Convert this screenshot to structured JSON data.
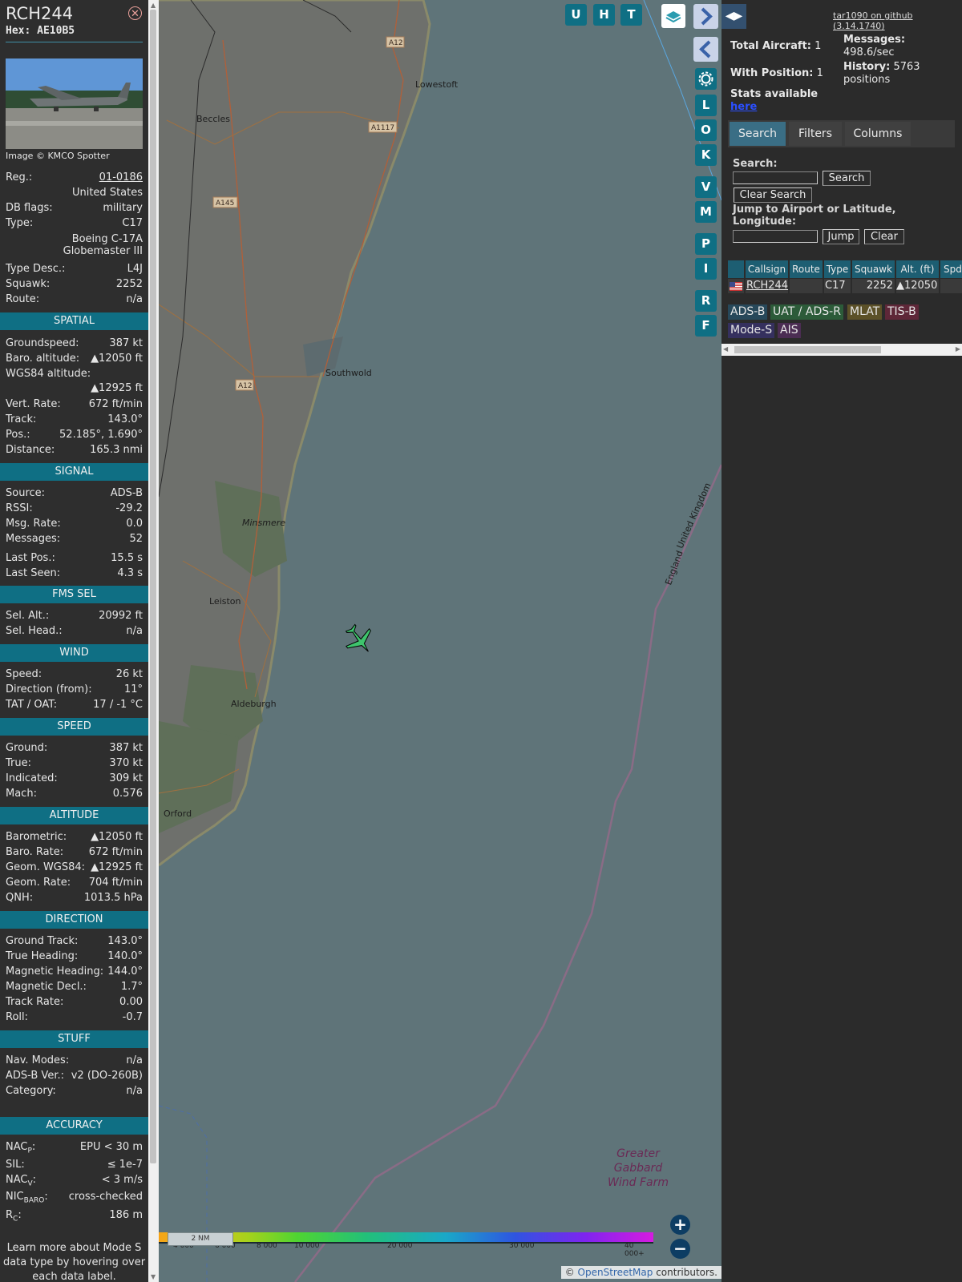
{
  "selected": {
    "callsign": "RCH244",
    "hex": "Hex: AE10B5",
    "photo_credit": "Image © KMCO Spotter",
    "summary": [
      {
        "k": "Reg.:",
        "v": "01-0186",
        "link": true
      },
      {
        "k": "",
        "v": "United States"
      },
      {
        "k": "DB flags:",
        "v": "military"
      },
      {
        "k": "Type:",
        "v": "C17"
      }
    ],
    "type_full_1": "Boeing C-17A",
    "type_full_2": "Globemaster III",
    "summary2": [
      {
        "k": "Type Desc.:",
        "v": "L4J"
      },
      {
        "k": "Squawk:",
        "v": "2252"
      },
      {
        "k": "Route:",
        "v": "n/a"
      }
    ],
    "spatial_title": "SPATIAL",
    "spatial": [
      {
        "k": "Groundspeed:",
        "v": "387 kt"
      },
      {
        "k": "Baro. altitude:",
        "v": "▲12050 ft"
      },
      {
        "k": "WGS84 altitude:",
        "v": ""
      }
    ],
    "wgs84_value": "▲12925 ft",
    "spatial2": [
      {
        "k": "Vert. Rate:",
        "v": "672 ft/min"
      },
      {
        "k": "Track:",
        "v": "143.0°"
      },
      {
        "k": "Pos.:",
        "v": "52.185°, 1.690°"
      },
      {
        "k": "Distance:",
        "v": "165.3 nmi"
      }
    ],
    "signal_title": "SIGNAL",
    "signal": [
      {
        "k": "Source:",
        "v": "ADS-B"
      },
      {
        "k": "RSSI:",
        "v": "-29.2"
      },
      {
        "k": "Msg. Rate:",
        "v": "0.0"
      },
      {
        "k": "Messages:",
        "v": "52"
      }
    ],
    "signal2": [
      {
        "k": "Last Pos.:",
        "v": "15.5 s"
      },
      {
        "k": "Last Seen:",
        "v": "4.3 s"
      }
    ],
    "fms_title": "FMS SEL",
    "fms": [
      {
        "k": "Sel. Alt.:",
        "v": "20992 ft"
      },
      {
        "k": "Sel. Head.:",
        "v": "n/a"
      }
    ],
    "wind_title": "WIND",
    "wind": [
      {
        "k": "Speed:",
        "v": "26 kt"
      },
      {
        "k": "Direction (from):",
        "v": "11°"
      },
      {
        "k": "TAT / OAT:",
        "v": "17 / -1 °C"
      }
    ],
    "speed_title": "SPEED",
    "speed": [
      {
        "k": "Ground:",
        "v": "387 kt"
      },
      {
        "k": "True:",
        "v": "370 kt"
      },
      {
        "k": "Indicated:",
        "v": "309 kt"
      },
      {
        "k": "Mach:",
        "v": "0.576"
      }
    ],
    "altitude_title": "ALTITUDE",
    "altitude": [
      {
        "k": "Barometric:",
        "v": "▲12050 ft"
      },
      {
        "k": "Baro. Rate:",
        "v": "672 ft/min"
      },
      {
        "k": "Geom. WGS84:",
        "v": "▲12925 ft"
      },
      {
        "k": "Geom. Rate:",
        "v": "704 ft/min"
      },
      {
        "k": "QNH:",
        "v": "1013.5 hPa"
      }
    ],
    "direction_title": "DIRECTION",
    "direction": [
      {
        "k": "Ground Track:",
        "v": "143.0°"
      },
      {
        "k": "True Heading:",
        "v": "140.0°"
      },
      {
        "k": "Magnetic Heading:",
        "v": "144.0°"
      },
      {
        "k": "Magnetic Decl.:",
        "v": "1.7°"
      },
      {
        "k": "Track Rate:",
        "v": "0.00"
      },
      {
        "k": "Roll:",
        "v": "-0.7"
      }
    ],
    "stuff_title": "STUFF",
    "stuff": [
      {
        "k": "Nav. Modes:",
        "v": "n/a"
      },
      {
        "k": "ADS-B Ver.:",
        "v": "v2 (DO-260B)"
      },
      {
        "k": "Category:",
        "v": "n/a"
      }
    ],
    "accuracy_title": "ACCURACY",
    "accuracy": [
      {
        "k": "NAC",
        "sub": "P",
        "post": ":",
        "v": "EPU < 30 m"
      },
      {
        "k": "SIL:",
        "v": "≤ 1e-7"
      },
      {
        "k": "NAC",
        "sub": "V",
        "post": ":",
        "v": "< 3 m/s"
      },
      {
        "k": "NIC",
        "sub": "BARO",
        "post": ":",
        "v": "cross-checked"
      },
      {
        "k": "R",
        "sub": "C",
        "post": ":",
        "v": "186 m"
      }
    ],
    "footer_1": "Learn more about Mode S",
    "footer_2": "data type by hovering over",
    "footer_3": "each data label."
  },
  "map": {
    "towns": [
      "Lowestoft",
      "Beccles",
      "Southwold",
      "Minsmere",
      "Leiston",
      "Aldeburgh",
      "Orford"
    ],
    "roads": [
      "A12",
      "A1117",
      "A145",
      "A12"
    ],
    "border_uk": "United Kingdom",
    "border_en": "England",
    "wind_farm": [
      "Greater",
      "Gabbard",
      "Wind Farm"
    ],
    "buttons": [
      "U",
      "H",
      "T"
    ],
    "side_buttons": [
      "L",
      "O",
      "K",
      "V",
      "M",
      "P",
      "I",
      "R",
      "F"
    ],
    "altitude_legend": [
      "4 000",
      "6 000",
      "8 000",
      "10 000",
      "20 000",
      "30 000",
      "40 000+"
    ],
    "scale_label": "2 NM",
    "attribution_prefix": "© ",
    "attribution_link": "OpenStreetMap",
    "attribution_suffix": " contributors.",
    "aircraft_color": "#3ec46d"
  },
  "panel": {
    "github_link": "tar1090 on github (3.14.1740)",
    "total_aircraft_label": "Total Aircraft:",
    "total_aircraft": "1",
    "with_position_label": "With Position:",
    "with_position": "1",
    "messages_label": "Messages:",
    "messages_rate": "498.6/sec",
    "history_label": "History:",
    "history_1": "5763",
    "history_2": "positions",
    "stats_text": "Stats available",
    "stats_link": "here",
    "tabs": [
      "Search",
      "Filters",
      "Columns"
    ],
    "search_label": "Search:",
    "search_value": "",
    "search_button": "Search",
    "clear_search_button": "Clear Search",
    "jump_label_1": "Jump to Airport or Latitude,",
    "jump_label_2": "Longitude:",
    "jump_value": "",
    "jump_button": "Jump",
    "clear_button": "Clear",
    "columns": [
      "Callsign",
      "Route",
      "Type",
      "Squawk",
      "Alt. (ft)",
      "Spd"
    ],
    "row": {
      "callsign": "RCH244",
      "route": "",
      "type": "C17",
      "squawk": "2252",
      "alt": "▲12050"
    },
    "source_chips": [
      "ADS-B",
      "UAT / ADS-R",
      "MLAT",
      "TIS-B",
      "Mode-S",
      "AIS"
    ]
  }
}
